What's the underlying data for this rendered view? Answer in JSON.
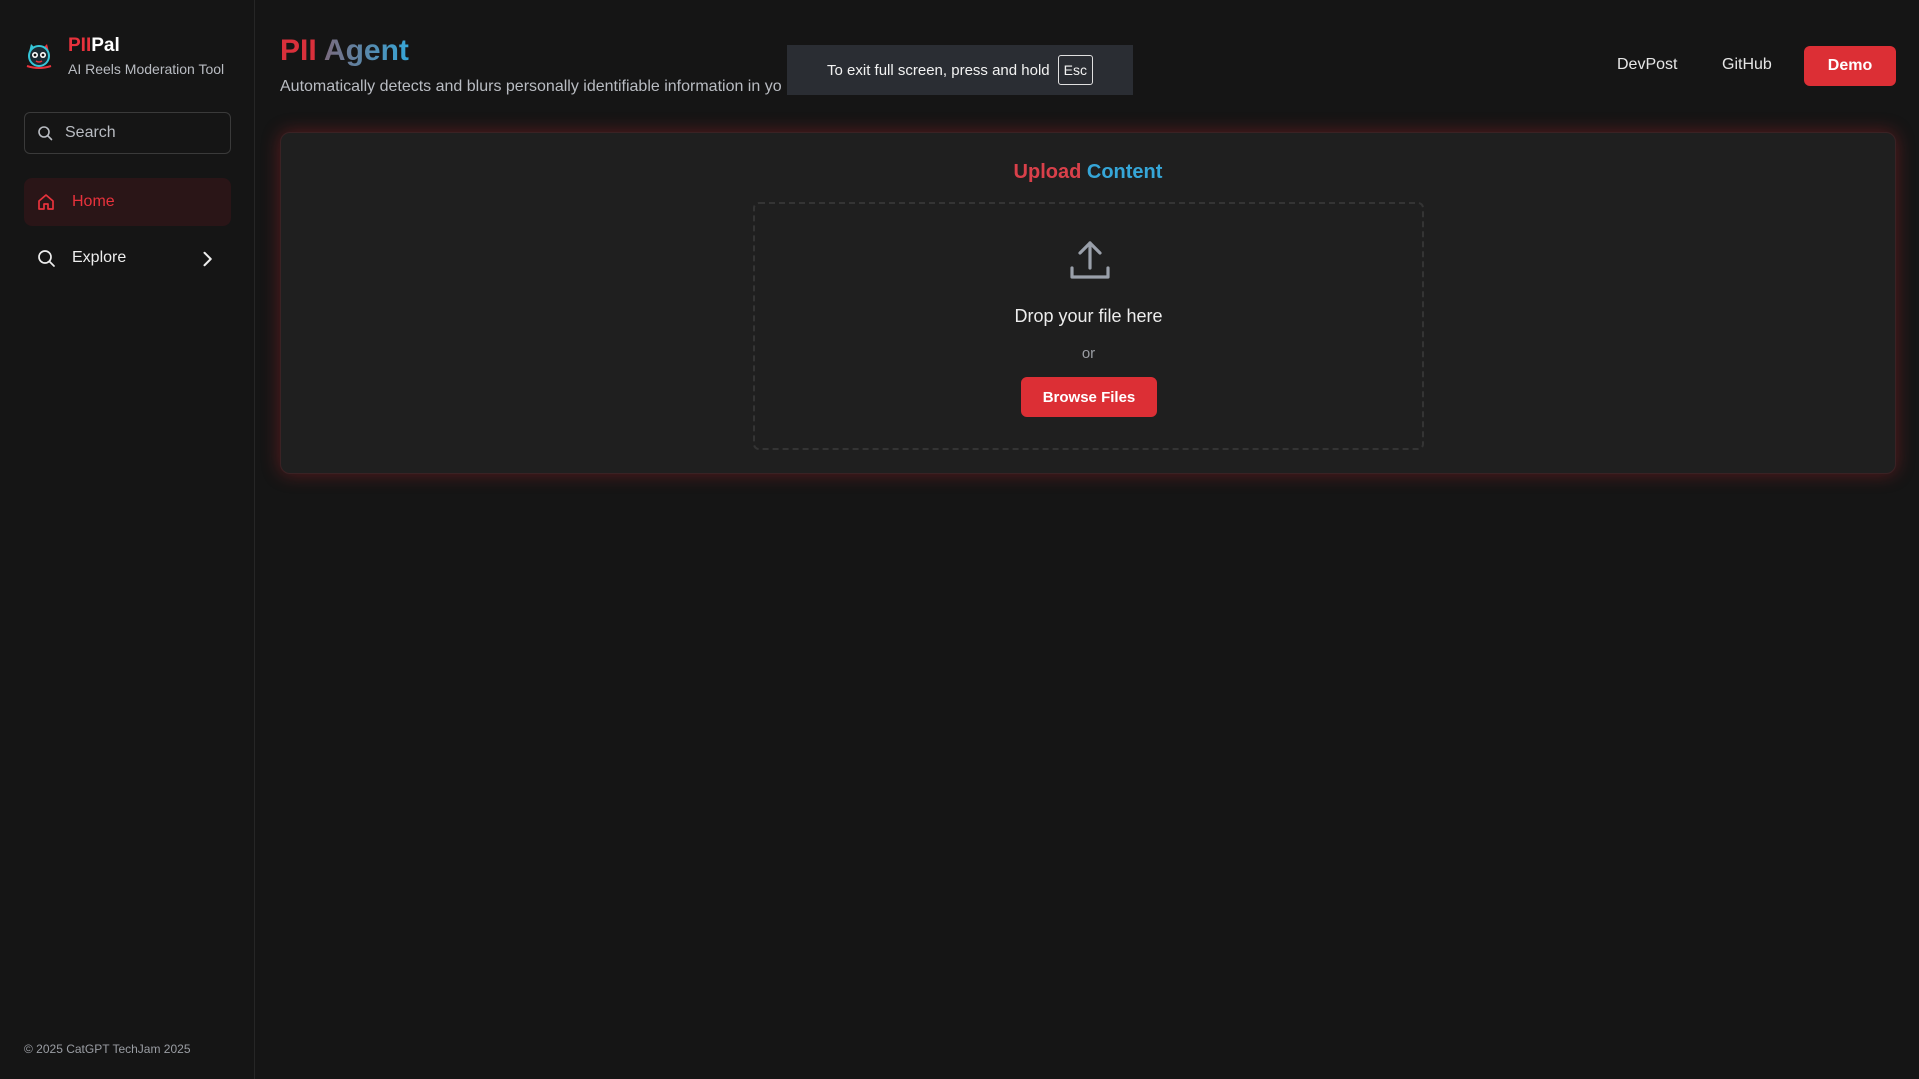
{
  "brand": {
    "name_part1": "PII",
    "name_part2": "Pal",
    "tagline": "AI Reels Moderation Tool"
  },
  "search": {
    "placeholder": "Search"
  },
  "nav": {
    "items": [
      {
        "label": "Home",
        "icon": "home-icon",
        "active": true
      },
      {
        "label": "Explore",
        "icon": "search-icon",
        "expandable": true
      }
    ]
  },
  "footer": {
    "copyright": "© 2025 CatGPT TechJam 2025"
  },
  "header": {
    "title_part1": "PII",
    "title_part2": "Agent",
    "subtitle": "Automatically detects and blurs personally identifiable information in yo",
    "links": {
      "devpost": "DevPost",
      "github": "GitHub"
    },
    "demo_label": "Demo"
  },
  "fullscreen_toast": {
    "text": "To exit full screen, press and hold",
    "key": "Esc"
  },
  "upload": {
    "title_part1": "Upload",
    "title_part2": "Content",
    "drop_text": "Drop your file here",
    "or_text": "or",
    "browse_label": "Browse Files"
  },
  "colors": {
    "accent": "#dc2f35",
    "secondary": "#36a6d8",
    "background": "#151515",
    "card": "#1f1f1f"
  }
}
